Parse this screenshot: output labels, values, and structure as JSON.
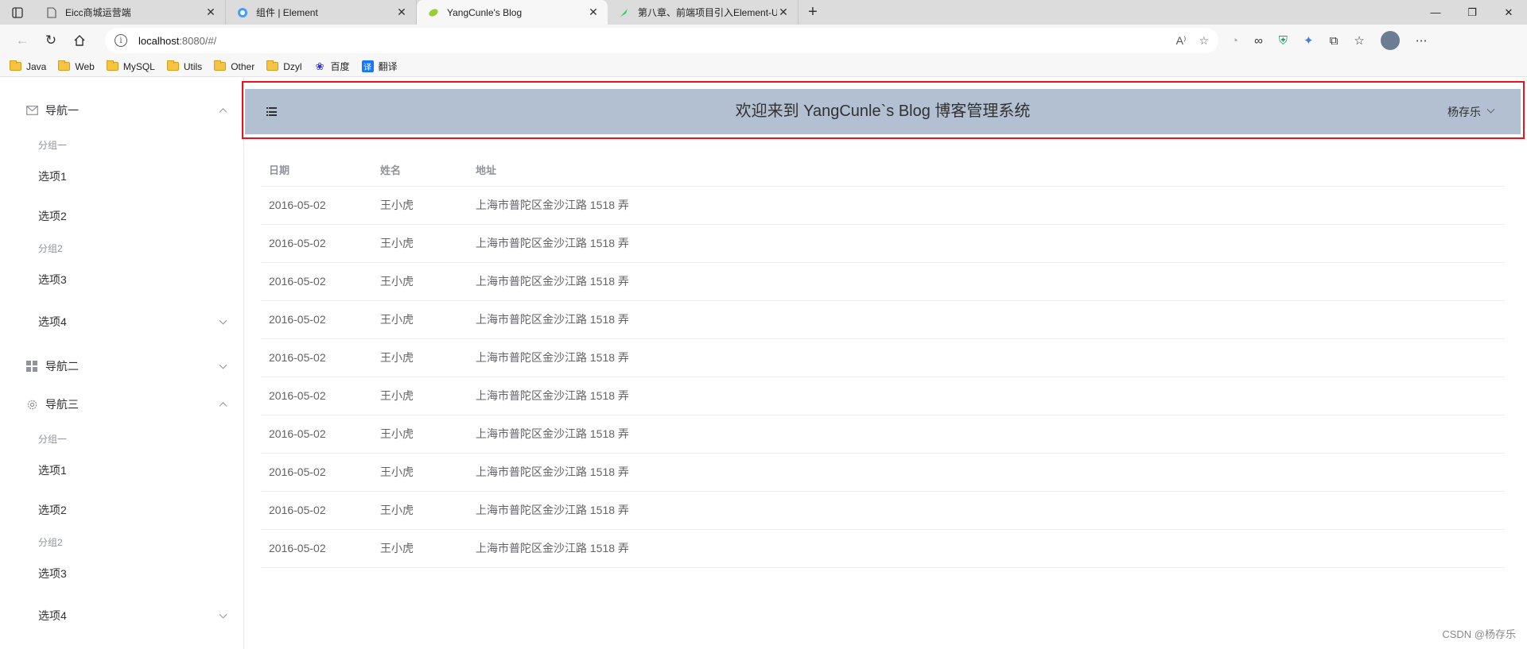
{
  "browser": {
    "tabs": [
      {
        "title": "Eicc商城运营端",
        "favicon": "page-icon",
        "active": false
      },
      {
        "title": "组件 | Element",
        "favicon": "element-icon",
        "active": false
      },
      {
        "title": "YangCunle's Blog",
        "favicon": "leaf-icon",
        "active": true
      },
      {
        "title": "第八章、前端项目引入Element-U",
        "favicon": "feather-icon",
        "active": false
      }
    ],
    "url_host": "localhost",
    "url_path": ":8080/#/",
    "bookmarks": [
      "Java",
      "Web",
      "MySQL",
      "Utils",
      "Other",
      "Dzyl",
      "百度",
      "翻译"
    ]
  },
  "sidebar": {
    "nav1": {
      "label": "导航一",
      "icon": "message-icon"
    },
    "nav1_group1": "分组一",
    "nav1_item1": "选项1",
    "nav1_item2": "选项2",
    "nav1_group2": "分组2",
    "nav1_item3": "选项3",
    "nav1_item4": "选项4",
    "nav2": {
      "label": "导航二",
      "icon": "menu-grid-icon"
    },
    "nav3": {
      "label": "导航三",
      "icon": "setting-icon"
    },
    "nav3_group1": "分组一",
    "nav3_item1": "选项1",
    "nav3_item2": "选项2",
    "nav3_group2": "分组2",
    "nav3_item3": "选项3",
    "nav3_item4": "选项4"
  },
  "header": {
    "title": "欢迎来到 YangCunle`s Blog 博客管理系统",
    "user": "杨存乐",
    "background": "#b3c0d1"
  },
  "table": {
    "columns": [
      "日期",
      "姓名",
      "地址"
    ],
    "rows": [
      [
        "2016-05-02",
        "王小虎",
        "上海市普陀区金沙江路 1518 弄"
      ],
      [
        "2016-05-02",
        "王小虎",
        "上海市普陀区金沙江路 1518 弄"
      ],
      [
        "2016-05-02",
        "王小虎",
        "上海市普陀区金沙江路 1518 弄"
      ],
      [
        "2016-05-02",
        "王小虎",
        "上海市普陀区金沙江路 1518 弄"
      ],
      [
        "2016-05-02",
        "王小虎",
        "上海市普陀区金沙江路 1518 弄"
      ],
      [
        "2016-05-02",
        "王小虎",
        "上海市普陀区金沙江路 1518 弄"
      ],
      [
        "2016-05-02",
        "王小虎",
        "上海市普陀区金沙江路 1518 弄"
      ],
      [
        "2016-05-02",
        "王小虎",
        "上海市普陀区金沙江路 1518 弄"
      ],
      [
        "2016-05-02",
        "王小虎",
        "上海市普陀区金沙江路 1518 弄"
      ],
      [
        "2016-05-02",
        "王小虎",
        "上海市普陀区金沙江路 1518 弄"
      ]
    ]
  },
  "watermark": "CSDN @杨存乐",
  "highlight_color": "#e8141c"
}
